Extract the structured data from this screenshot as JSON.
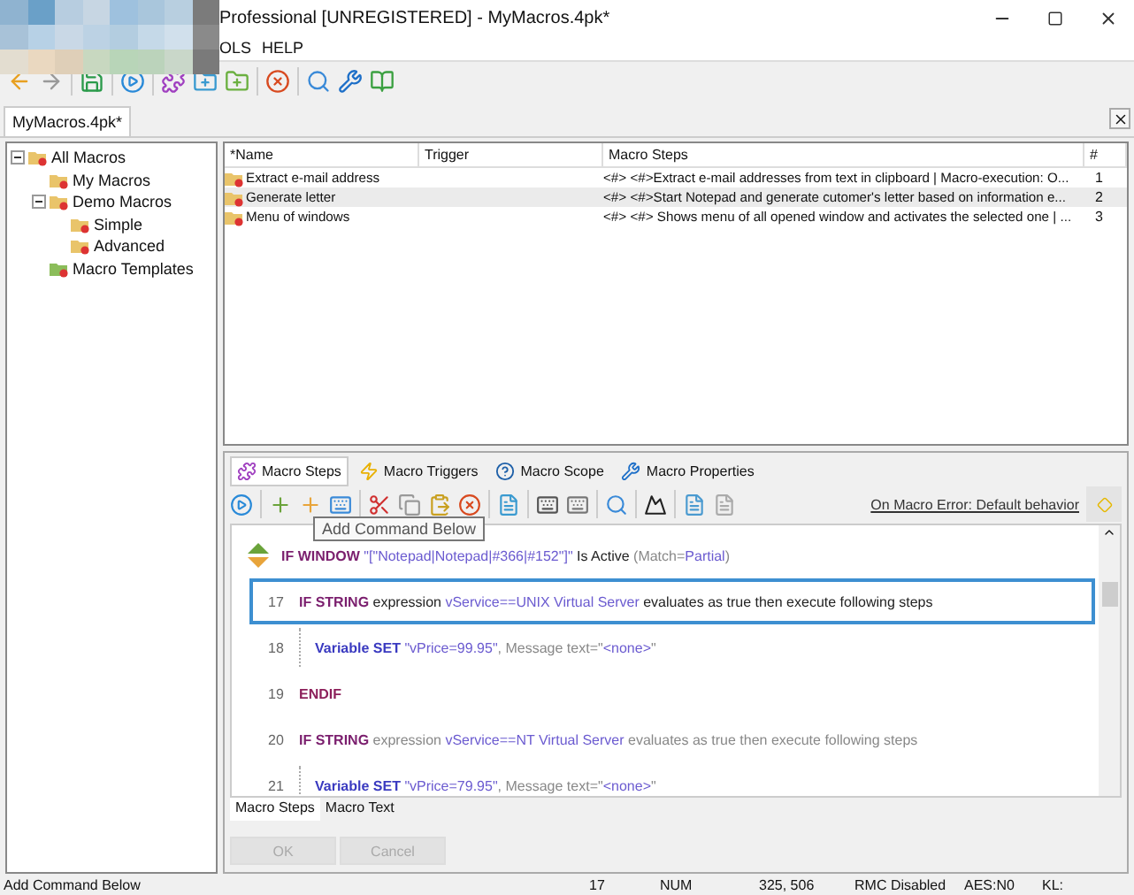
{
  "window": {
    "title": "Professional [UNREGISTERED] - MyMacros.4pk*"
  },
  "menu": [
    "OLS",
    "HELP"
  ],
  "doc_tab": {
    "label": "MyMacros.4pk*",
    "selected": true
  },
  "tree": [
    {
      "label": "All Macros",
      "expanded": true,
      "children": [
        {
          "label": "My Macros"
        },
        {
          "label": "Demo Macros",
          "expanded": true,
          "children": [
            {
              "label": "Simple"
            },
            {
              "label": "Advanced"
            }
          ]
        },
        {
          "label": "Macro Templates",
          "kind": "template"
        }
      ]
    }
  ],
  "table": {
    "columns": [
      "*Name",
      "Trigger",
      "Macro Steps",
      "#"
    ],
    "rows": [
      {
        "name": "Extract e-mail address",
        "steps": "<#> <#>Extract e-mail addresses from text in clipboard | Macro-execution: O...",
        "number": "1",
        "selected": false
      },
      {
        "name": "Generate letter",
        "steps": "<#> <#>Start Notepad and generate cutomer's letter based on information e...",
        "number": "2",
        "selected": true
      },
      {
        "name": "Menu of windows",
        "steps": "<#> <#> Shows menu of all opened window and activates the selected one | ...",
        "number": "3",
        "selected": false
      }
    ]
  },
  "editor_tabs": [
    {
      "label": "Macro Steps",
      "selected": true
    },
    {
      "label": "Macro Triggers",
      "selected": false
    },
    {
      "label": "Macro Scope",
      "selected": false
    },
    {
      "label": "Macro Properties",
      "selected": false
    }
  ],
  "error_link": "On Macro Error: Default behavior",
  "tooltip": "Add Command Below",
  "steps": [
    {
      "kind": "if",
      "keyword": "IF WINDOW",
      "selected": false,
      "parts": [
        {
          "text": " \"[\"Notepad|Notepad|#366|#152\"]\"",
          "kind": "value"
        },
        {
          "text": " Is Active ",
          "kind": "text"
        },
        {
          "text": "(Match=",
          "kind": "muted"
        },
        {
          "text": "Partial",
          "kind": "value"
        },
        {
          "text": ")",
          "kind": "muted"
        }
      ],
      "children": [
        {
          "kind": "if",
          "number": "17",
          "keyword": "IF STRING",
          "selected": true,
          "parts": [
            {
              "text": " expression ",
              "kind": "text"
            },
            {
              "text": "vService==UNIX Virtual Server",
              "kind": "value"
            },
            {
              "text": " evaluates as true then execute following steps",
              "kind": "text"
            }
          ],
          "children": [
            {
              "kind": "set",
              "number": "18",
              "keyword": "Variable SET",
              "selected": false,
              "parts": [
                {
                  "text": " \"vPrice=99.95\"",
                  "kind": "value"
                },
                {
                  "text": ", Message text=\"",
                  "kind": "muted"
                },
                {
                  "text": "<none>",
                  "kind": "value"
                },
                {
                  "text": "\"",
                  "kind": "muted"
                }
              ]
            }
          ]
        },
        {
          "kind": "endif",
          "number": "19",
          "keyword": "ENDIF",
          "selected": false
        },
        {
          "kind": "if",
          "number": "20",
          "keyword": "IF STRING",
          "selected": false,
          "parts": [
            {
              "text": " expression ",
              "kind": "muted"
            },
            {
              "text": "vService==NT Virtual Server",
              "kind": "value"
            },
            {
              "text": " evaluates as true then execute following steps",
              "kind": "muted"
            }
          ],
          "children": [
            {
              "kind": "set",
              "number": "21",
              "keyword": "Variable SET",
              "selected": false,
              "parts": [
                {
                  "text": " \"vPrice=79.95\"",
                  "kind": "value"
                },
                {
                  "text": ", Message text=\"",
                  "kind": "muted"
                },
                {
                  "text": "<none>",
                  "kind": "value"
                },
                {
                  "text": "\"",
                  "kind": "muted"
                }
              ]
            }
          ]
        }
      ]
    }
  ],
  "view_tabs": [
    {
      "label": "Macro Steps",
      "selected": true
    },
    {
      "label": "Macro Text",
      "selected": false
    }
  ],
  "buttons": [
    {
      "label": "OK",
      "disabled": true
    },
    {
      "label": "Cancel",
      "disabled": true
    }
  ],
  "status_bar": [
    "Add Command Below",
    "17",
    "NUM",
    "325, 506",
    "RMC Disabled",
    "AES:N0",
    "KL:"
  ]
}
